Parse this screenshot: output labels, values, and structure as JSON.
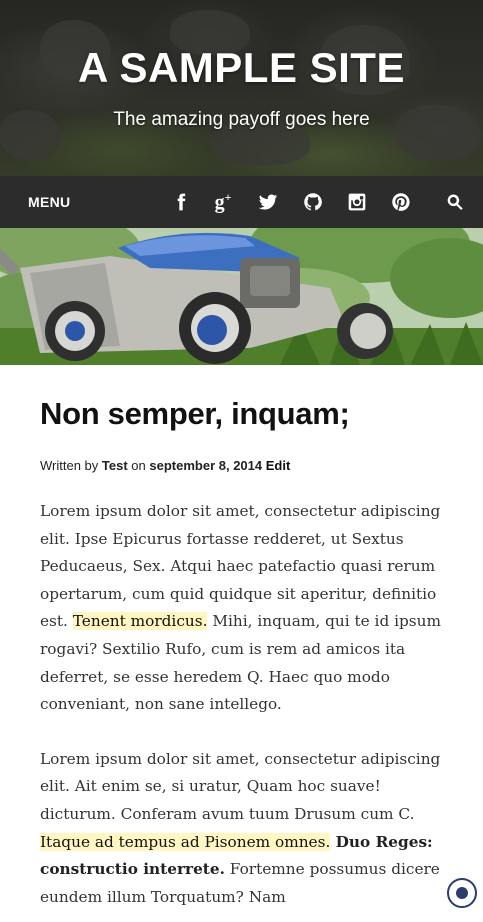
{
  "site": {
    "title": "A SAMPLE SITE",
    "tagline": "The amazing payoff goes here"
  },
  "nav": {
    "menu_label": "MENU",
    "icons": [
      "facebook-icon",
      "google-plus-icon",
      "twitter-icon",
      "github-icon",
      "instagram-icon",
      "pinterest-icon",
      "search-icon"
    ],
    "gplus_glyph": "g+"
  },
  "featured_image": {
    "subject": "lawn-mower-image"
  },
  "post": {
    "title": "Non semper, inquam;",
    "meta": {
      "written_by": "Written by",
      "author": "Test",
      "on": "on",
      "date": "september 8, 2014",
      "edit": "Edit"
    },
    "p1": {
      "before": "Lorem ipsum dolor sit amet, consectetur adipiscing elit. Ipse Epicurus fortasse redderet, ut Sextus Peducaeus, Sex. Atqui haec patefactio quasi rerum opertarum, cum quid quidque sit aperitur, definitio est. ",
      "highlight": "Tenent mordicus.",
      "after": " Mihi, inquam, qui te id ipsum rogavi? Sextilio Rufo, cum is rem ad amicos ita deferret, se esse heredem Q. Haec quo modo conveniant, non sane intellego."
    },
    "p2": {
      "before": "Lorem ipsum dolor sit amet, consectetur adipiscing elit. Ait enim se, si uratur, Quam hoc suave! dicturum. Conferam avum tuum Drusum cum C. ",
      "highlight": "Itaque ad tempus ad Pisonem omnes.",
      "strong": " Duo Reges: constructio interrete.",
      "after": " Fortemne possumus dicere eundem illum Torquatum? Nam"
    }
  },
  "colors": {
    "navbar_bg": "#2c2c2c",
    "highlight_bg": "#fff6c2",
    "widget_accent": "#2b3e6b"
  }
}
